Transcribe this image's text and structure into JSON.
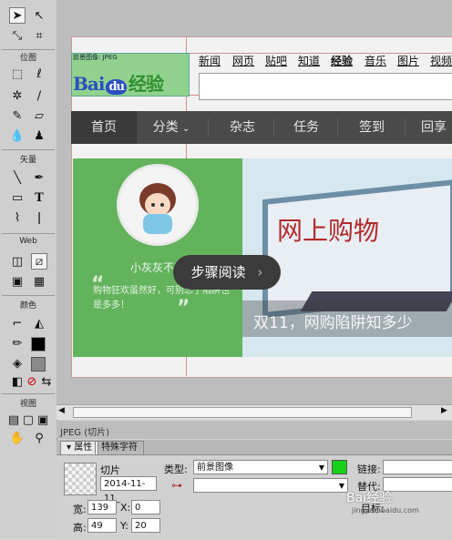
{
  "tools_panel": {
    "sections": [
      "位图",
      "矢量",
      "Web",
      "颜色",
      "视图"
    ]
  },
  "canvas": {
    "slice_label": "前景图像: JPEG",
    "logo": {
      "part1": "Bai",
      "part2": "du",
      "part3": "经验"
    },
    "nav_links": [
      "新闻",
      "网页",
      "贴吧",
      "知道",
      "经验",
      "音乐",
      "图片",
      "视频"
    ],
    "menu": [
      "首页",
      "分类",
      "杂志",
      "任务",
      "签到",
      "回享"
    ],
    "menu_arrow": "⌄",
    "card": {
      "username": "小灰灰不丢",
      "quote": "购物狂欢虽然好，可别忘了陷阱也是多多！",
      "quote_open": "“",
      "quote_close": "”"
    },
    "banner": {
      "title": "网上购物",
      "caption": "双11，网购陷阱知多少"
    },
    "step_button": {
      "label": "步骤阅读",
      "arrow": "›"
    }
  },
  "status": {
    "text": "JPEG (切片)"
  },
  "property_panel": {
    "tabs": [
      "属性",
      "特殊字符"
    ],
    "object_type": "切片",
    "name_value": "2014-11-11_",
    "type_label": "类型:",
    "type_value": "前景图像",
    "link_label": "链接:",
    "alt_label": "替代:",
    "target_label": "目标:",
    "width_label": "宽:",
    "width_value": "139",
    "height_label": "高:",
    "height_value": "49",
    "x_label": "X:",
    "x_value": "0",
    "y_label": "Y:",
    "y_value": "20",
    "accent_color": "#18d018"
  },
  "watermark": {
    "text": "Bai经验",
    "sub": "jingyan.baidu.com"
  }
}
